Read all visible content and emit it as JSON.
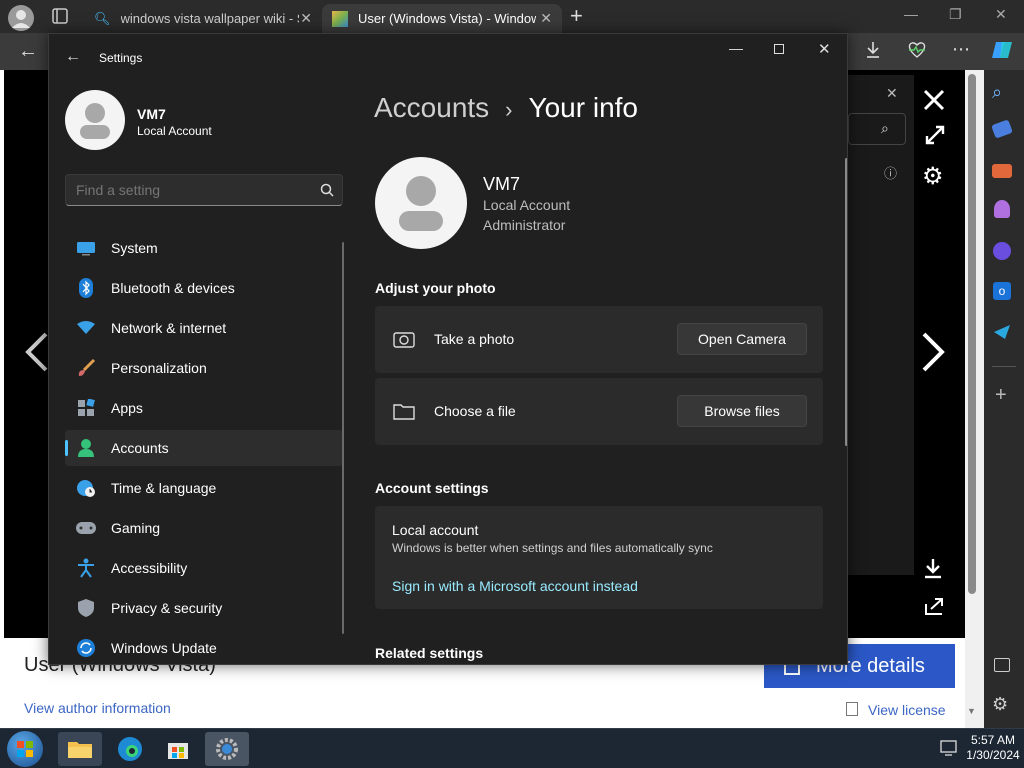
{
  "browser": {
    "tabs": [
      {
        "title": "windows vista wallpaper wiki - Se",
        "active": false
      },
      {
        "title": "User (Windows Vista) - Windows",
        "active": true
      }
    ],
    "new_tab_symbol": "+"
  },
  "viewer": {
    "image_title": "User (Windows Vista)",
    "more_details_label": "More details",
    "author_link": "View author information",
    "license_link": "View license"
  },
  "settings": {
    "window_title": "Settings",
    "user": {
      "name": "VM7",
      "account_type": "Local Account",
      "role": "Administrator"
    },
    "search_placeholder": "Find a setting",
    "nav": [
      {
        "label": "System",
        "icon": "system-icon"
      },
      {
        "label": "Bluetooth & devices",
        "icon": "bluetooth-icon"
      },
      {
        "label": "Network & internet",
        "icon": "wifi-icon"
      },
      {
        "label": "Personalization",
        "icon": "brush-icon"
      },
      {
        "label": "Apps",
        "icon": "apps-icon"
      },
      {
        "label": "Accounts",
        "icon": "accounts-icon",
        "selected": true
      },
      {
        "label": "Time & language",
        "icon": "globe-clock-icon"
      },
      {
        "label": "Gaming",
        "icon": "gamepad-icon"
      },
      {
        "label": "Accessibility",
        "icon": "accessibility-icon"
      },
      {
        "label": "Privacy & security",
        "icon": "shield-icon"
      },
      {
        "label": "Windows Update",
        "icon": "update-icon"
      }
    ],
    "breadcrumb": {
      "parent": "Accounts",
      "separator": "›",
      "current": "Your info"
    },
    "adjust_photo_heading": "Adjust your photo",
    "take_photo_label": "Take a photo",
    "open_camera_label": "Open Camera",
    "choose_file_label": "Choose a file",
    "browse_files_label": "Browse files",
    "account_settings_heading": "Account settings",
    "local_account_title": "Local account",
    "local_account_desc": "Windows is better when settings and files automatically sync",
    "sign_in_link": "Sign in with a Microsoft account instead",
    "related_settings_heading": "Related settings"
  },
  "taskbar": {
    "time": "5:57 AM",
    "date": "1/30/2024"
  },
  "colors": {
    "accent": "#4cc2ff",
    "link": "#99ebff",
    "more_details_bg": "#2b58c6"
  }
}
